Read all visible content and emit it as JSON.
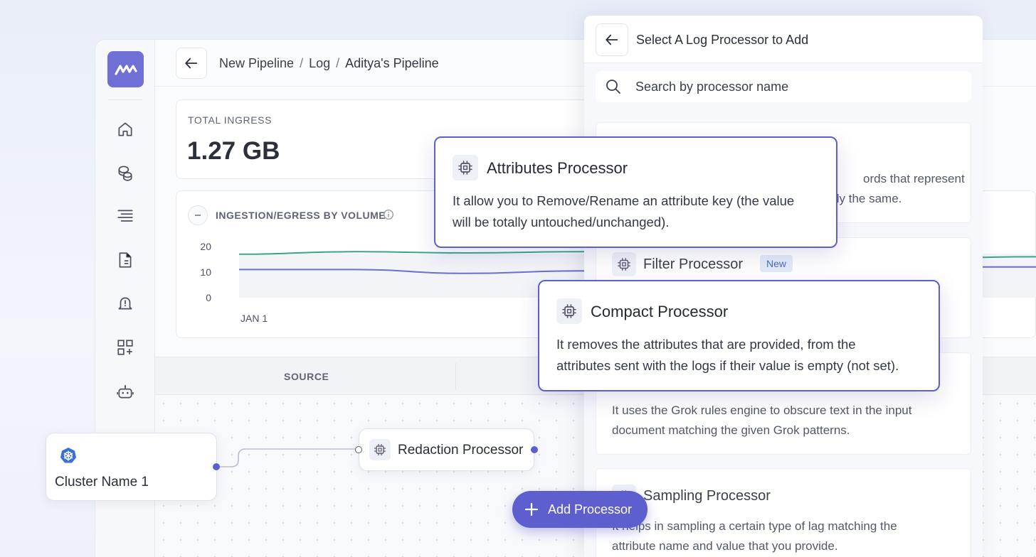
{
  "topbar": {
    "breadcrumb": [
      "New Pipeline",
      "Log",
      "Aditya's Pipeline"
    ],
    "separator": "/"
  },
  "sidebar": {
    "items": [
      "home-icon",
      "coins-icon",
      "logs-icon",
      "document-icon",
      "alert-icon",
      "dashboard-add-icon",
      "robot-icon"
    ]
  },
  "stats": {
    "label": "TOTAL INGRESS",
    "value": "1.27 GB"
  },
  "chart": {
    "title": "INGESTION/EGRESS BY VOLUME"
  },
  "chart_data": {
    "type": "line",
    "ylim": [
      0,
      20
    ],
    "yticks": [
      "20",
      "10",
      "0"
    ],
    "xticks": [
      "JAN 1"
    ],
    "grid": false,
    "series": [
      {
        "color": "#3aa58a",
        "values": [
          17,
          18,
          17.5,
          18,
          19.5,
          17,
          15.5,
          16
        ]
      },
      {
        "color": "#6a6fd0",
        "values": [
          11,
          11,
          9.5,
          10.5,
          8.5,
          13,
          12,
          12
        ]
      }
    ]
  },
  "table": {
    "source_header": "SOURCE"
  },
  "pipeline": {
    "source_node": "Cluster Name 1",
    "processor_node": "Redaction Processor",
    "add_button": "Add Processor"
  },
  "panel": {
    "title": "Select A Log Processor to Add",
    "search_placeholder": "Search by processor name",
    "items": [
      {
        "desc_line1": "ords that represent",
        "desc_line2": "tly the same."
      },
      {
        "title": "Filter Processor",
        "badge": "New"
      },
      {
        "desc_line1": "It uses the Grok rules engine to obscure text in the input",
        "desc_line2": "document matching the given Grok patterns."
      },
      {
        "title": "Sampling Processor",
        "desc_line1": "It helps in sampling a certain type of lag matching the",
        "desc_line2": "attribute name and value that you provide."
      }
    ]
  },
  "popovers": {
    "attributes": {
      "title": "Attributes Processor",
      "desc_line1": "It allow you to Remove/Rename an attribute key (the value",
      "desc_line2": "will be totally untouched/unchanged)."
    },
    "compact": {
      "title": "Compact Processor",
      "desc_line1": "It removes the attributes that are provided, from the",
      "desc_line2": "attributes sent with the logs if their value is empty (not set)."
    }
  },
  "colors": {
    "accent": "#5c5fcd",
    "logo_bg": "#6f6fd6",
    "series_green": "#3aa58a",
    "series_purple": "#6a6fd0"
  }
}
